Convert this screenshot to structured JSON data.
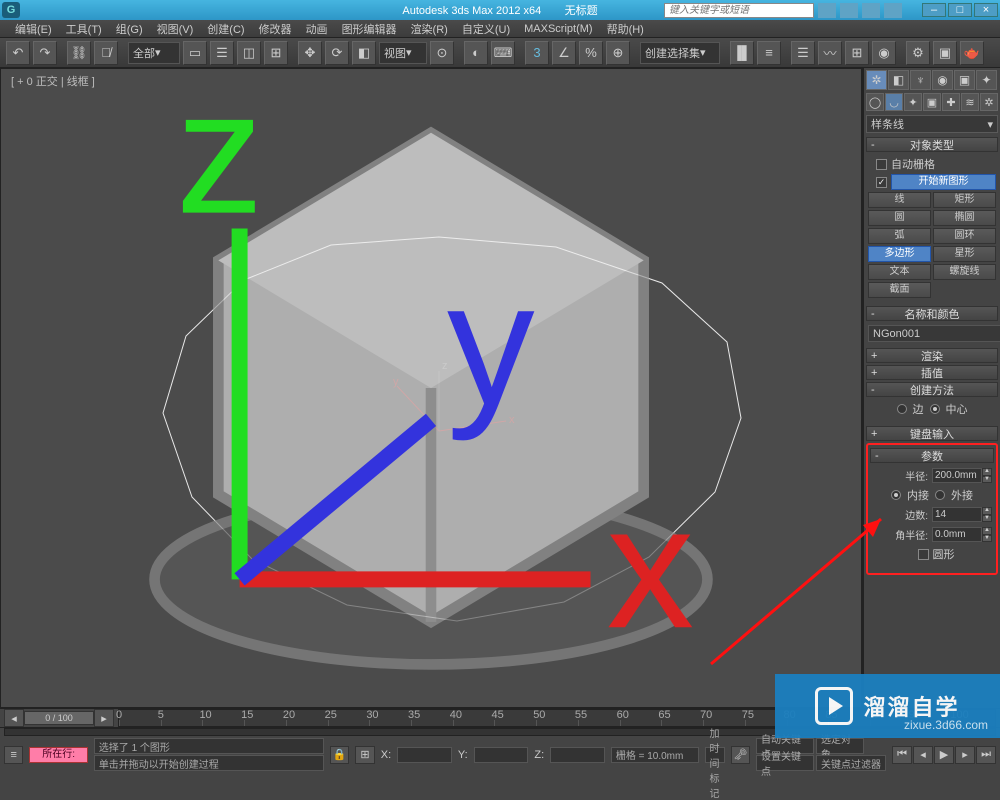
{
  "title": {
    "app": "Autodesk 3ds Max 2012 x64",
    "doc": "无标题",
    "search_ph": "键入关键字或短语"
  },
  "menu": [
    "编辑(E)",
    "工具(T)",
    "组(G)",
    "视图(V)",
    "创建(C)",
    "修改器",
    "动画",
    "图形编辑器",
    "渲染(R)",
    "自定义(U)",
    "MAXScript(M)",
    "帮助(H)"
  ],
  "toolbar": {
    "all_dropdown": "全部",
    "view_dropdown": "视图",
    "create_sel": "创建选择集"
  },
  "viewport": {
    "label": "[ + 0 正交 | 线框 ]"
  },
  "panel": {
    "shape_dropdown": "样条线",
    "roll_objtype": "对象类型",
    "autogrid": "自动栅格",
    "start_new": "开始新图形",
    "buttons": {
      "line": "线",
      "rect": "矩形",
      "circle": "圆",
      "ellipse": "椭圆",
      "arc": "弧",
      "donut": "圆环",
      "ngon": "多边形",
      "star": "星形",
      "text": "文本",
      "helix": "螺旋线",
      "section": "截面"
    },
    "roll_name": "名称和颜色",
    "name_val": "NGon001",
    "roll_render": "渲染",
    "roll_interp": "插值",
    "roll_method": "创建方法",
    "method_edge": "边",
    "method_center": "中心",
    "roll_keyboard": "键盘输入",
    "roll_params": "参数",
    "radius_lab": "半径:",
    "radius_val": "200.0mm",
    "inscribed": "内接",
    "circum": "外接",
    "sides_lab": "边数:",
    "sides_val": "14",
    "corner_lab": "角半径:",
    "corner_val": "0.0mm",
    "circular": "圆形"
  },
  "status": {
    "timeslider": "0 / 100",
    "pink": "所在行:",
    "sel": "选择了 1 个图形",
    "hint": "单击并拖动以开始创建过程",
    "addtime": "添加时间标记",
    "x": "X:",
    "y": "Y:",
    "z": "Z:",
    "grid": "栅格 = 10.0mm",
    "autokey": "自动关键点",
    "selobj": "选定对象",
    "setkey": "设置关键点",
    "keyfilter": "关键点过滤器"
  },
  "watermark": {
    "text": "溜溜自学",
    "url": "zixue.3d66.com"
  }
}
